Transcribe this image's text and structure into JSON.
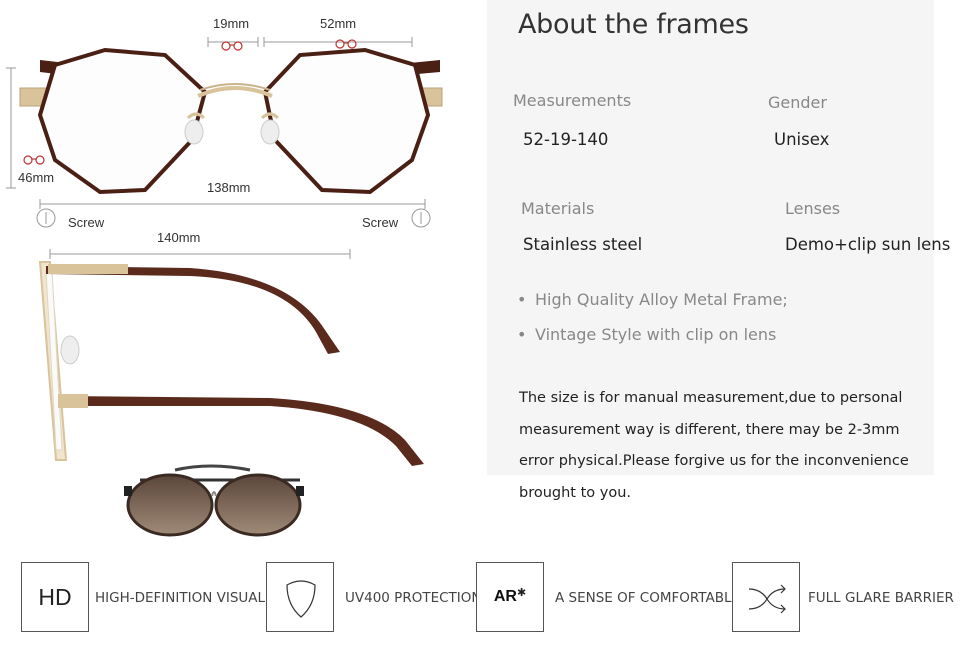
{
  "diagram": {
    "bridge_width": "19mm",
    "lens_width": "52mm",
    "lens_height": "46mm",
    "frame_width": "138mm",
    "screw_left": "Screw",
    "screw_right": "Screw",
    "temple_length": "140mm"
  },
  "about": {
    "title": "About the frames",
    "measurements_label": "Measurements",
    "measurements_value": "52-19-140",
    "gender_label": "Gender",
    "gender_value": "Unisex",
    "materials_label": "Materials",
    "materials_value": "Stainless steel",
    "lenses_label": "Lenses",
    "lenses_value": "Demo+clip sun lens",
    "bullets": [
      "High Quality Alloy Metal Frame;",
      "Vintage Style with clip on lens"
    ],
    "note": "The size is for manual measurement,due to personal measurement way is different, there may be 2-3mm error physical.Please forgive us for the inconvenience brought to you."
  },
  "features": [
    {
      "icon": "hd-icon",
      "box_label": "HD",
      "text": "HIGH-DEFINITION VISUAL"
    },
    {
      "icon": "shield-icon",
      "text": "UV400 PROTECTION"
    },
    {
      "icon": "ar-coating-icon",
      "box_label": "AR",
      "text": "A SENSE OF COMFORTABLE"
    },
    {
      "icon": "shuffle-arrows-icon",
      "text": "FULL GLARE BARRIER"
    }
  ],
  "colors": {
    "frame_brown": "#4a1f14",
    "frame_gold": "#d8c39a",
    "panel_bg": "#f5f5f5",
    "lens_brown": "#6e5a4c"
  }
}
